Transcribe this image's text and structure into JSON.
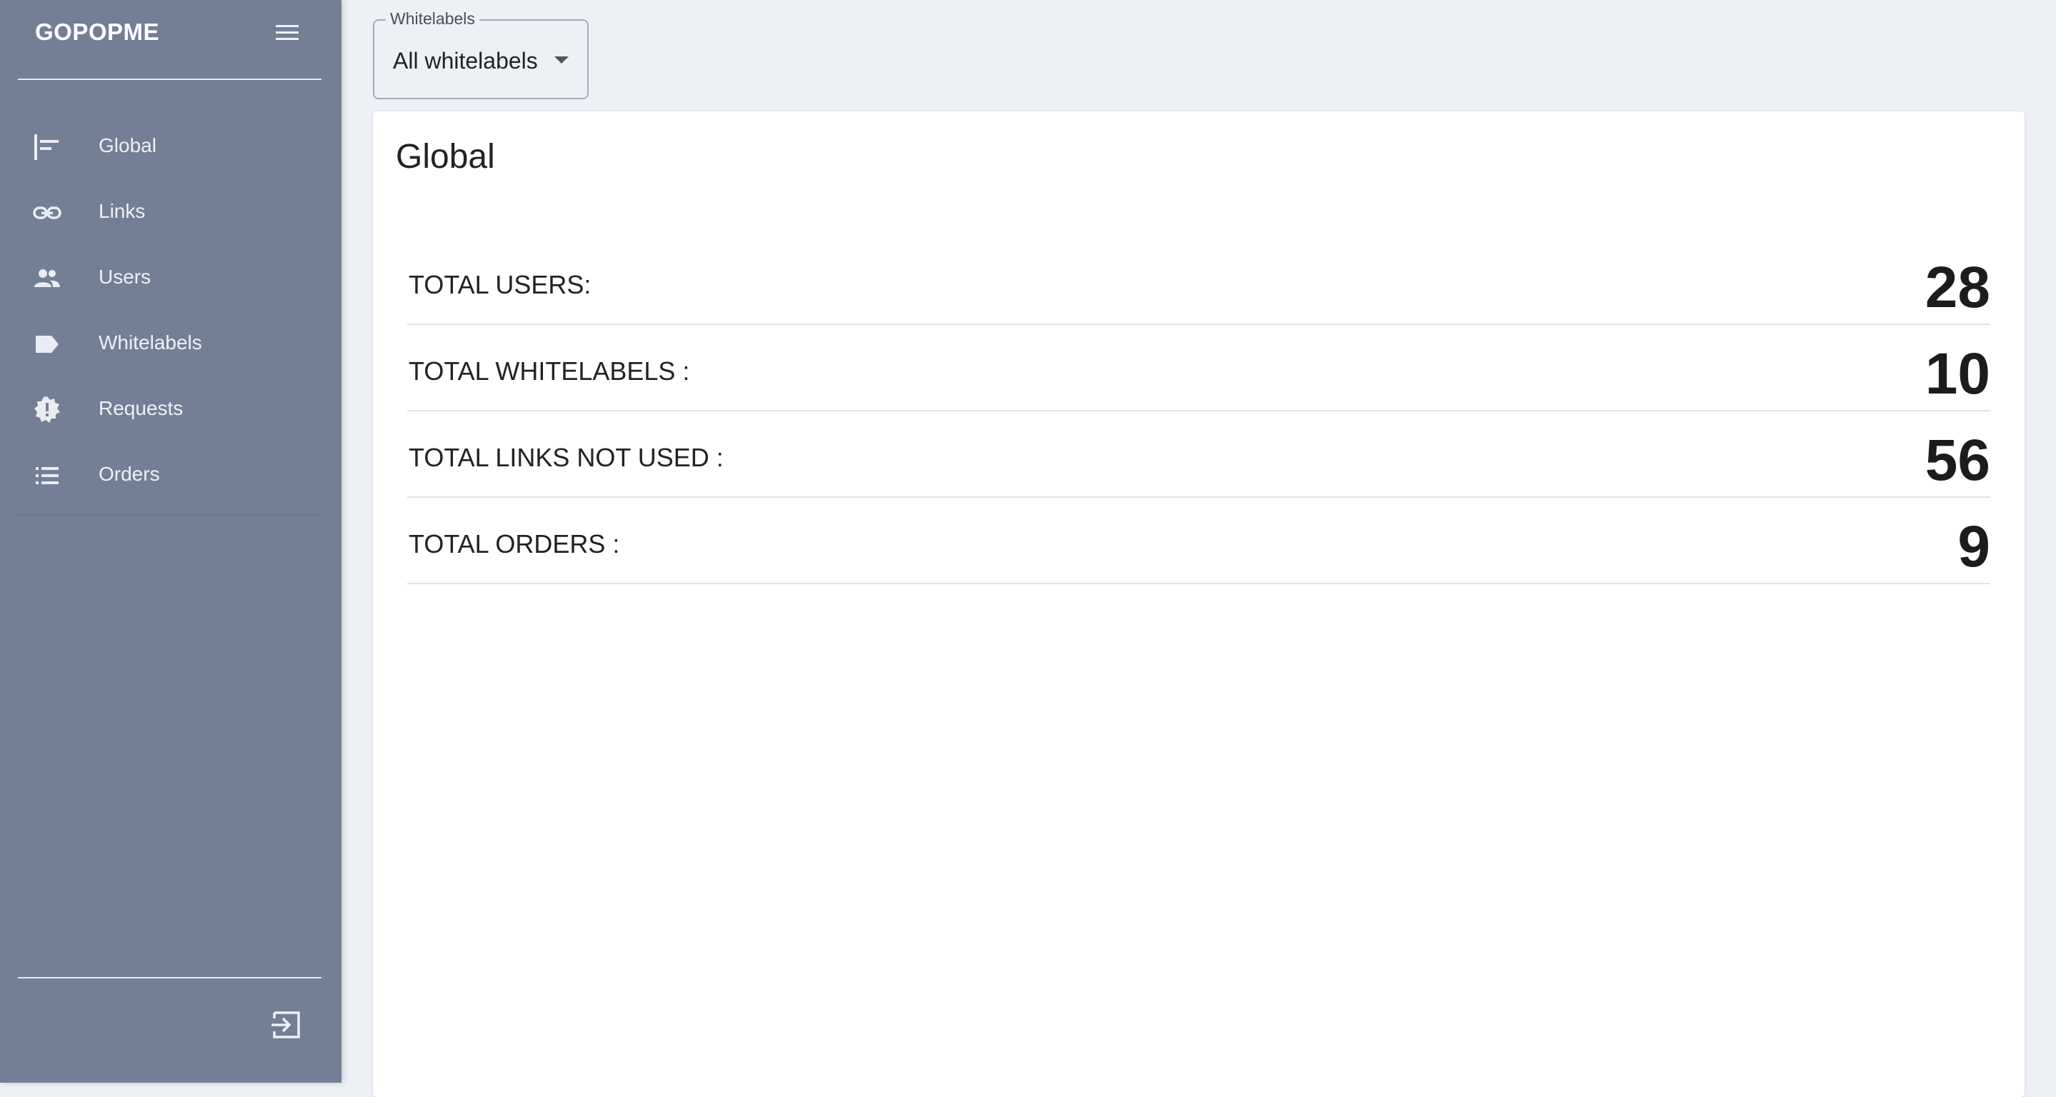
{
  "sidebar": {
    "brand": "GOPOPME",
    "items": [
      {
        "label": "Global",
        "icon": "global-icon"
      },
      {
        "label": "Links",
        "icon": "link-icon"
      },
      {
        "label": "Users",
        "icon": "users-icon"
      },
      {
        "label": "Whitelabels",
        "icon": "label-icon"
      },
      {
        "label": "Requests",
        "icon": "alert-badge-icon"
      },
      {
        "label": "Orders",
        "icon": "list-icon"
      }
    ]
  },
  "filter": {
    "legend": "Whitelabels",
    "value": "All whitelabels"
  },
  "card": {
    "title": "Global",
    "stats": [
      {
        "label": "TOTAL USERS:",
        "value": "28"
      },
      {
        "label": "TOTAL WHITELABELS :",
        "value": "10"
      },
      {
        "label": "TOTAL LINKS NOT USED :",
        "value": "56"
      },
      {
        "label": "TOTAL ORDERS :",
        "value": "9"
      }
    ]
  },
  "colors": {
    "sidebar_bg": "#737f94",
    "page_bg": "#edf0f5",
    "card_bg": "#ffffff"
  }
}
